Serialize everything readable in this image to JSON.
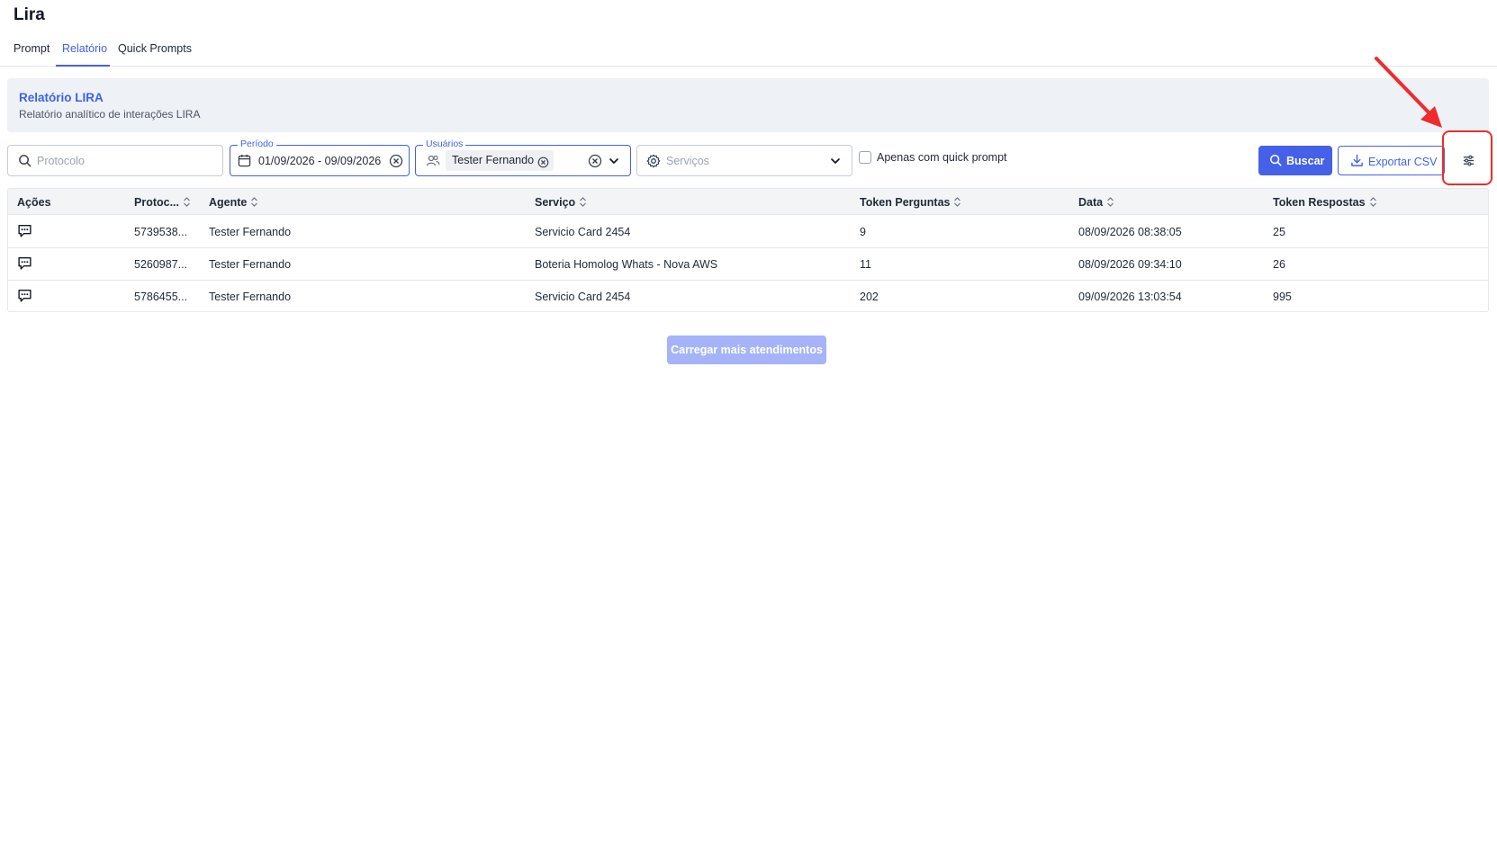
{
  "app": {
    "title": "Lira"
  },
  "tabs": [
    {
      "label": "Prompt",
      "active": false
    },
    {
      "label": "Relatório",
      "active": true
    },
    {
      "label": "Quick Prompts",
      "active": false
    }
  ],
  "banner": {
    "title": "Relatório LIRA",
    "subtitle": "Relatório analítico de interações LIRA"
  },
  "filters": {
    "protocolo": {
      "placeholder": "Protocolo",
      "value": ""
    },
    "periodo": {
      "label": "Período",
      "value": "01/09/2026 - 09/09/2026"
    },
    "usuarios": {
      "label": "Usuários",
      "selected": [
        "Tester Fernando"
      ]
    },
    "servicos": {
      "placeholder": "Serviços",
      "value": ""
    },
    "quick_prompt_only": {
      "label": "Apenas com quick prompt",
      "checked": false
    }
  },
  "actions": {
    "search_label": "Buscar",
    "export_label": "Exportar CSV",
    "settings_icon": "sliders-icon"
  },
  "table": {
    "columns": [
      "Ações",
      "Protoc...",
      "Agente",
      "Serviço",
      "Token Perguntas",
      "Data",
      "Token Respostas"
    ],
    "rows": [
      {
        "protocolo": "5739538...",
        "agente": "Tester Fernando",
        "servico": "Servicio Card 2454",
        "token_perguntas": "9",
        "data": "08/09/2026 08:38:05",
        "token_respostas": "25"
      },
      {
        "protocolo": "5260987...",
        "agente": "Tester Fernando",
        "servico": "Boteria Homolog Whats - Nova AWS",
        "token_perguntas": "11",
        "data": "08/09/2026 09:34:10",
        "token_respostas": "26"
      },
      {
        "protocolo": "5786455...",
        "agente": "Tester Fernando",
        "servico": "Servicio Card 2454",
        "token_perguntas": "202",
        "data": "09/09/2026 13:03:54",
        "token_respostas": "995"
      }
    ]
  },
  "load_more": {
    "label": "Carregar mais atendimentos",
    "disabled": true
  },
  "colors": {
    "accent": "#4461e8",
    "accent_disabled": "#a5b4f8",
    "annotation": "#ef2b2b",
    "banner_bg": "#eef1f6"
  }
}
